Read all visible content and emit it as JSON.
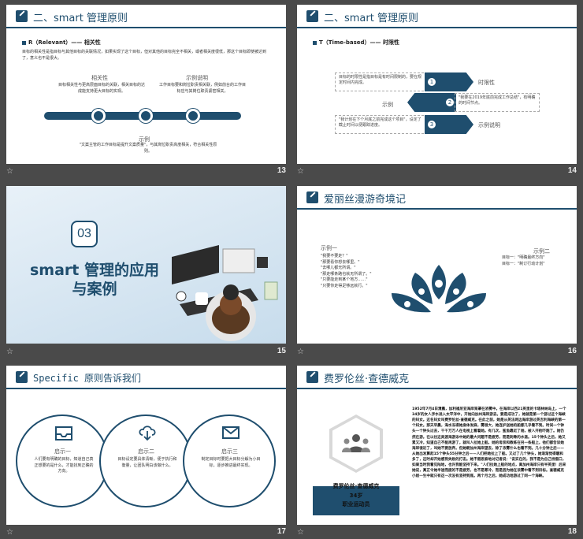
{
  "slide13": {
    "title": "二、smart 管理原则",
    "subtitle": "R（Relevant）—— 相关性",
    "body": "目标的相关性是指目标与其他目标的关联情况，如果实现了这个目标，但对其他的目标完全不相关，或者相关度很低，那这个目标即使被达到了，意义也不是很大。",
    "col1_title": "相关性",
    "col1_text": "目标相关性与更高层面目标的关联，相关目标的达成能支持更大目标的实现。",
    "col2_title": "示例说明",
    "col2_text": "工作目标要和岗位职责相关联，例如前台的工作目标应与其岗位职责紧密相关。",
    "example_title": "示例",
    "example_text": "\"文案主管的工作目标是提升文案质量\"，与其岗位职责高度相关，符合相关性原则。",
    "page": "13"
  },
  "slide14": {
    "title": "二、smart 管理原则",
    "subtitle": "T（Time-based）—— 时限性",
    "box1": "目标的时限性是指目标是有时间限制的，要在规定时间内完成。",
    "label1": "时限性",
    "box2": "\"我要在2019年底前完成工作总结\"，有明确的时间节点。",
    "label2": "示例",
    "box3": "\"我计划在下个月底之前完成这个项目\"，设定了截止时间以便跟踪进度。",
    "label3": "示例说明",
    "page": "14"
  },
  "slide15": {
    "number": "03",
    "title_line1": "smart 管理的应用",
    "title_line2": "与案例",
    "page": "15"
  },
  "slide16": {
    "title": "爱丽丝漫游奇境记",
    "left_title": "示例一",
    "left_lines": [
      "\"我要不要走？\"",
      "\"那要看你想去哪里。\"",
      "\"去哪儿都无所谓。\"",
      "\"那走哪条路也就无所谓了。\"",
      "\"只要能走到某个地方……\"",
      "\"只要你走得足够远就行。\""
    ],
    "right_title": "示例二",
    "right_lines": [
      "目标一：\"明确最终方向\"",
      "目标一：\"制订行动计划\""
    ],
    "page": "16"
  },
  "slide17": {
    "title": "Specific 原则告诉我们",
    "c1_title": "启示一",
    "c1_text": "人们要有明确的目标，知道自己真正想要的是什么，才能找到正确的方向。",
    "c2_title": "启示二",
    "c2_text": "目标设定要具体清晰，便于执行和衡量，让团队明白该做什么。",
    "c3_title": "启示三",
    "c3_text": "制定目标时要把大目标分解为小目标，逐步推进最终实现。",
    "page": "17"
  },
  "slide18": {
    "title": "费罗伦丝·查德威克",
    "name": "费罗伦丝·查德威克",
    "age": "34岁",
    "job": "职业运动员",
    "story": "1952年7月4日清晨，加利福尼亚海岸笼罩在浓雾中。在海岸以西21英里的卡塔林纳岛上，一个34岁的女人涉水进入太平洋中，开始向加州海岸游去。要是成功了，她就是第一个游过这个海峡的妇女。这名妇女叫费罗伦丝·查德威克。在此之前，她是从英法两边海岸游过英吉利海峡的第一个妇女。那天早晨，海水冻得她身体发麻，雾很大，她连护送她的船都几乎看不到。时间一个钟头一个钟头过去，千千万万人在电视上看着她。有几次，鲨鱼靠近了她，被人开枪吓跑了。她仍然在游。在以往这类渡海游泳中她的最大问题不是疲劳，而是刺骨的水温。15个钟头之后，她又累又冷，知道自己不能再游了，就叫人拉她上船。她的母亲和教练在另一条船上，他们都告诉她海岸很近了，叫她不要放弃。但她朝加州海岸望去，除了浓雾什么也看不到。几十分钟之后——从她出发算起15个钟头55分钟之后——人们把她拉上了船。又过了几个钟头，她渐渐觉得暖和多了，这时却开始感到失败的打击。她不假思索地对记者说：\"说实在的，我不是为自己找借口，如果当时我看见陆地，也许我能坚持下来。\"人们拉她上船的地点，离加州海岸只有半英里！后来她说，真正令她半途而废的不是疲劳，也不是寒冷，而是因为她在浓雾中看不到目标。查德威克小姐一生中就只有这一次没有坚持到底。两个月之后，她成功地游过了同一个海峡。",
    "page": "18"
  }
}
